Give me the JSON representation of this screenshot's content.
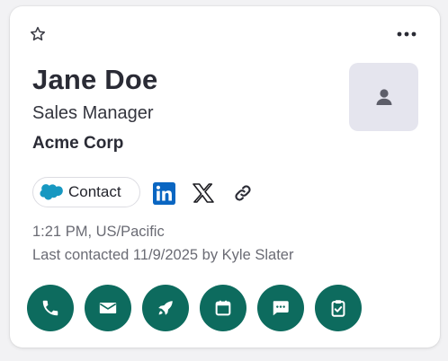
{
  "person": {
    "name": "Jane Doe",
    "title": "Sales Manager",
    "company": "Acme Corp"
  },
  "crm_chip": {
    "label": "Contact",
    "icon": "salesforce-cloud-icon"
  },
  "social_links": [
    "linkedin-icon",
    "x-twitter-icon",
    "link-icon"
  ],
  "meta": {
    "local_time": "1:21 PM, US/Pacific",
    "last_contacted": "Last contacted 11/9/2025 by Kyle Slater"
  },
  "header_icons": [
    "star-icon",
    "more-options-icon"
  ],
  "actions": [
    "phone-icon",
    "email-icon",
    "rocket-icon",
    "calendar-icon",
    "message-icon",
    "clipboard-check-icon"
  ],
  "colors": {
    "action_bg": "#0d6b5e",
    "avatar_bg": "#e5e5ee",
    "salesforce": "#1798c1",
    "linkedin": "#0a66c2"
  }
}
